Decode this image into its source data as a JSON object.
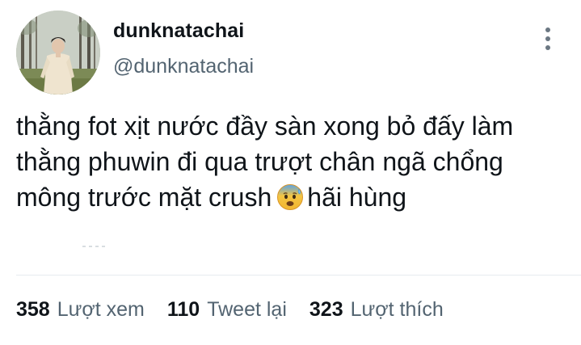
{
  "user": {
    "display_name": "dunknatachai",
    "handle": "@dunknatachai"
  },
  "tweet": {
    "lines": [
      "thằng fot xịt nước đầy sàn xong bỏ đấy làm",
      "thằng phuwin đi qua trượt chân ngã chổng",
      "mông trước mặt crush"
    ],
    "after_emoji": "hãi hùng",
    "emoji": "anxious-face-with-sweat-icon"
  },
  "stats": {
    "views_count": "358",
    "views_label": "Lượt xem",
    "retweets_count": "110",
    "retweets_label": "Tweet lại",
    "likes_count": "323",
    "likes_label": "Lượt thích"
  },
  "colors": {
    "text": "#0f1419",
    "secondary": "#536471",
    "divider": "#e6ebef"
  }
}
